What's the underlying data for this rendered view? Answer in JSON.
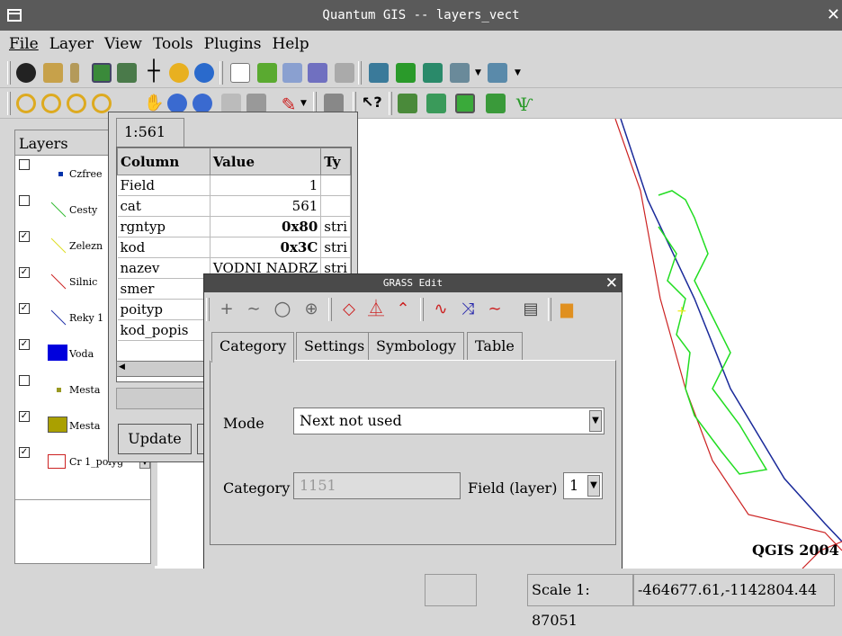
{
  "window": {
    "title": "Quantum GIS -- layers_vect"
  },
  "menu": [
    "File",
    "Layer",
    "View",
    "Tools",
    "Plugins",
    "Help"
  ],
  "layers_panel": {
    "title": "Layers",
    "items": [
      {
        "label": "Czfree",
        "checked": false,
        "color": "#0033aa"
      },
      {
        "label": "Cesty",
        "checked": false,
        "color": "#33bb33"
      },
      {
        "label": "Zelezn",
        "checked": true,
        "color": "#dddd22"
      },
      {
        "label": "Silnic",
        "checked": true,
        "color": "#cc2222"
      },
      {
        "label": "Reky 1",
        "checked": true,
        "color": "#2233aa"
      },
      {
        "label": "Voda",
        "checked": true,
        "color": "#0000dd"
      },
      {
        "label": "Mesta",
        "checked": false,
        "color": "#999922"
      },
      {
        "label": "Mesta",
        "checked": true,
        "color": "#aaa000"
      },
      {
        "label": "Cr 1_polyg",
        "checked": true,
        "color": "#cc2222"
      }
    ]
  },
  "attributes": {
    "tab": "1:561",
    "columns": [
      "Column",
      "Value",
      "Ty"
    ],
    "rows": [
      [
        "Field",
        "1",
        ""
      ],
      [
        "cat",
        "561",
        ""
      ],
      [
        "rgntyp",
        "0x80",
        "stri"
      ],
      [
        "kod",
        "0x3C",
        "stri"
      ],
      [
        "nazev",
        "VODNI NADRZ",
        "stri"
      ],
      [
        "smer",
        "",
        ""
      ],
      [
        "poityp",
        "",
        ""
      ],
      [
        "kod_popis",
        "",
        ""
      ]
    ],
    "update_button": "Update"
  },
  "grass_edit": {
    "title": "GRASS Edit",
    "tabs": [
      "Category",
      "Settings",
      "Symbology",
      "Table"
    ],
    "mode_label": "Mode",
    "mode_value": "Next not used",
    "category_label": "Category",
    "category_value": "1151",
    "field_label": "Field (layer)",
    "field_value": "1"
  },
  "map": {
    "watermark": "QGIS 2004"
  },
  "status": {
    "scale": "Scale 1: 87051",
    "coords": "-464677.61,-1142804.44"
  }
}
